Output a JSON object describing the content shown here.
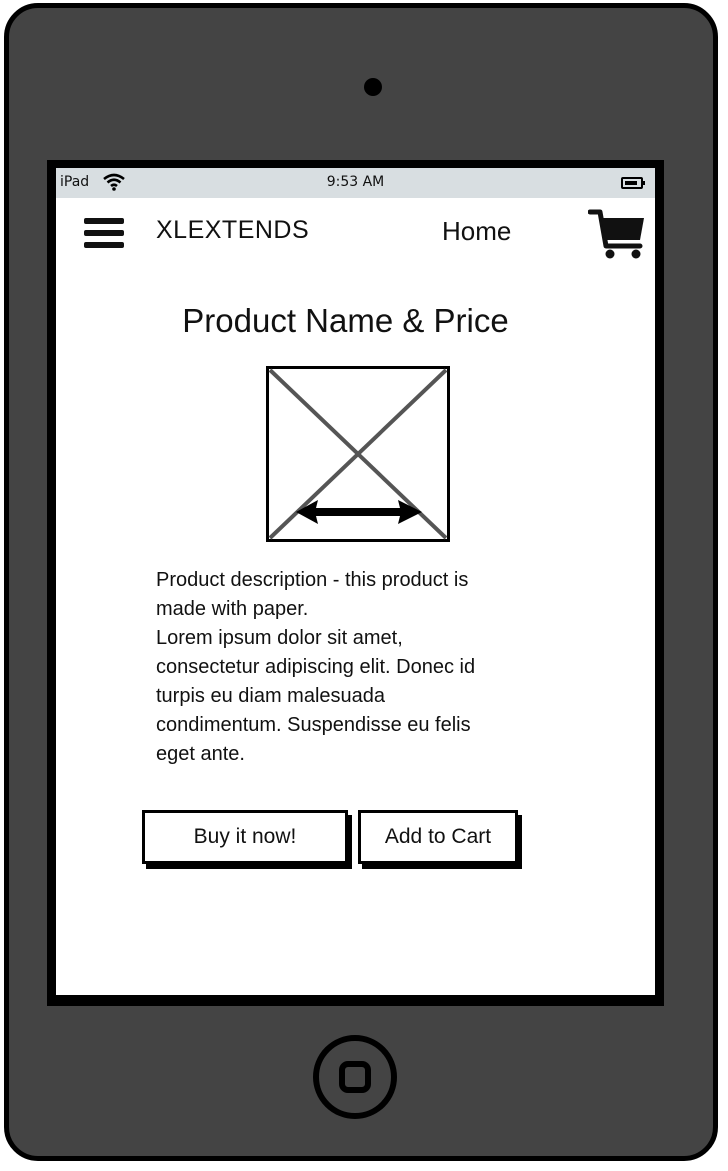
{
  "status_bar": {
    "device": "iPad",
    "time": "9:53 AM"
  },
  "header": {
    "brand": "XLEXTENDS",
    "nav_home": "Home"
  },
  "product": {
    "title": "Product Name & Price",
    "description": "Product description - this product is\nmade with paper.\nLorem ipsum dolor sit amet,\nconsectetur adipiscing elit. Donec id\nturpis eu diam malesuada\ncondimentum. Suspendisse eu felis\neget ante."
  },
  "actions": {
    "buy_now": "Buy it now!",
    "add_to_cart": "Add to Cart"
  },
  "icons": {
    "menu": "hamburger-menu-icon",
    "cart": "shopping-cart-icon",
    "wifi": "wifi-icon",
    "battery": "battery-icon",
    "image": "image-placeholder-icon"
  },
  "colors": {
    "device_body": "#444444",
    "status_bar": "#d8dee1",
    "ink": "#111111"
  }
}
